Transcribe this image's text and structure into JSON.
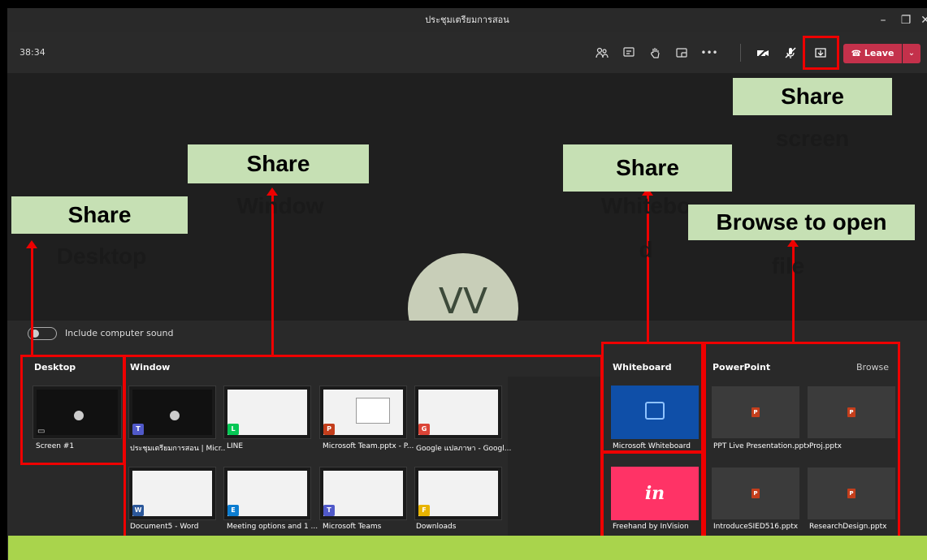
{
  "window": {
    "title": "ประชุมเตรียมการสอน",
    "minimize": "–",
    "restore": "❐",
    "close": "✕"
  },
  "meeting_bar": {
    "timer": "38:34",
    "icons": [
      "participants-icon",
      "chat-icon",
      "raise-hand-icon",
      "rooms-icon",
      "more-icon",
      "camera-off-icon",
      "mic-off-icon",
      "share-icon"
    ],
    "leave_label": "Leave"
  },
  "avatar": {
    "initials": "VV"
  },
  "share_tray": {
    "include_sound_label": "Include computer sound",
    "desktop": {
      "title": "Desktop",
      "screen_label": "Screen #1"
    },
    "window": {
      "title": "Window",
      "items": [
        {
          "caption": "ประชุมเตรียมการสอน | Micr...",
          "app": "T"
        },
        {
          "caption": "LINE",
          "app": "L"
        },
        {
          "caption": "Microsoft Team.pptx - P...",
          "app": "P"
        },
        {
          "caption": "Google แปลภาษา - Googl...",
          "app": "G"
        },
        {
          "caption": "Document5 - Word",
          "app": "W"
        },
        {
          "caption": "Meeting options and 1 ...",
          "app": "E"
        },
        {
          "caption": "Microsoft Teams",
          "app": "T"
        },
        {
          "caption": "Downloads",
          "app": "F"
        }
      ]
    },
    "whiteboard": {
      "title": "Whiteboard",
      "items": [
        {
          "caption": "Microsoft Whiteboard",
          "color": "#0f4fa8"
        },
        {
          "caption": "Freehand by InVision",
          "color": "#ff3366",
          "glyph": "in"
        }
      ]
    },
    "powerpoint": {
      "title": "PowerPoint",
      "browse_label": "Browse",
      "files": [
        "PPT Live Presentation.pptx",
        "Proj.pptx",
        "IntroduceSIED516.pptx",
        "ResearchDesign.pptx"
      ]
    }
  },
  "annotations": {
    "share_desktop": [
      "Share",
      "Desktop"
    ],
    "share_window": [
      "Share",
      "Window"
    ],
    "share_whiteboard": [
      "Share",
      "Whitebo",
      "d"
    ],
    "browse_file": [
      "Browse to open",
      "file"
    ],
    "share_screen": [
      "Share",
      "screen"
    ],
    "color_label_bg": "#c6e0b4",
    "color_highlight": "#ee0000"
  }
}
